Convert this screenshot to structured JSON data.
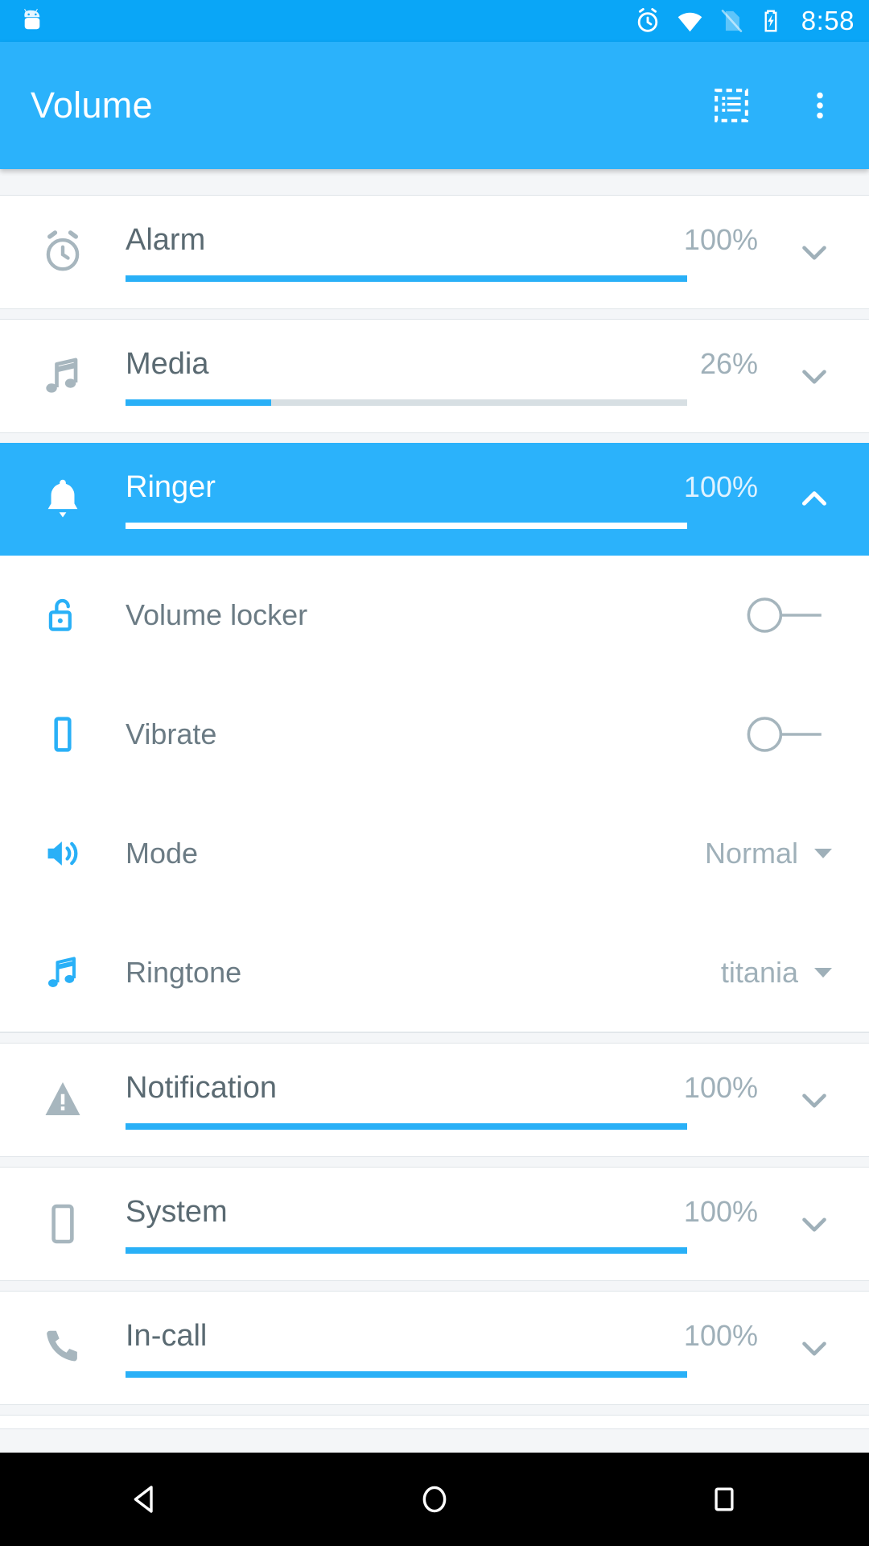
{
  "status_bar": {
    "app_icon": "android-head-icon",
    "icons": [
      "alarm-icon",
      "wifi-icon",
      "sim-off-icon",
      "battery-charging-icon"
    ],
    "time": "8:58",
    "background_color": "#0aa6f7"
  },
  "toolbar": {
    "title": "Volume",
    "background_color": "#2bb2fb",
    "actions": [
      {
        "name": "presets-button",
        "icon": "list-dashed-icon"
      },
      {
        "name": "overflow-menu-button",
        "icon": "more-vert-icon"
      }
    ]
  },
  "accent_color": "#29b0f7",
  "volume_streams": [
    {
      "id": "alarm",
      "label": "Alarm",
      "percent_label": "100%",
      "percent": 100,
      "icon": "alarm-clock-icon",
      "expanded": false,
      "chevron": "chevron-down-icon",
      "highlighted": false
    },
    {
      "id": "media",
      "label": "Media",
      "percent_label": "26%",
      "percent": 26,
      "icon": "music-note-icon",
      "expanded": false,
      "chevron": "chevron-down-icon",
      "highlighted": false
    },
    {
      "id": "ringer",
      "label": "Ringer",
      "percent_label": "100%",
      "percent": 100,
      "icon": "bell-icon",
      "expanded": true,
      "chevron": "chevron-up-icon",
      "highlighted": true
    },
    {
      "id": "notification",
      "label": "Notification",
      "percent_label": "100%",
      "percent": 100,
      "icon": "warning-triangle-icon",
      "expanded": false,
      "chevron": "chevron-down-icon",
      "highlighted": false
    },
    {
      "id": "system",
      "label": "System",
      "percent_label": "100%",
      "percent": 100,
      "icon": "phone-device-icon",
      "expanded": false,
      "chevron": "chevron-down-icon",
      "highlighted": false
    },
    {
      "id": "incall",
      "label": "In-call",
      "percent_label": "100%",
      "percent": 100,
      "icon": "phone-handset-icon",
      "expanded": false,
      "chevron": "chevron-down-icon",
      "highlighted": false
    }
  ],
  "ringer_options": [
    {
      "id": "volume-locker",
      "label": "Volume locker",
      "icon": "padlock-open-icon",
      "control": "toggle",
      "value": "off"
    },
    {
      "id": "vibrate",
      "label": "Vibrate",
      "icon": "vibrate-phone-icon",
      "control": "toggle",
      "value": "off"
    },
    {
      "id": "mode",
      "label": "Mode",
      "icon": "speaker-icon",
      "control": "dropdown",
      "value": "Normal"
    },
    {
      "id": "ringtone",
      "label": "Ringtone",
      "icon": "music-note-icon",
      "control": "dropdown",
      "value": "titania"
    }
  ],
  "nav_bar": {
    "background_color": "#000000",
    "buttons": [
      {
        "name": "back-button",
        "icon": "triangle-back-icon"
      },
      {
        "name": "home-button",
        "icon": "circle-home-icon"
      },
      {
        "name": "recents-button",
        "icon": "square-recents-icon"
      }
    ]
  }
}
